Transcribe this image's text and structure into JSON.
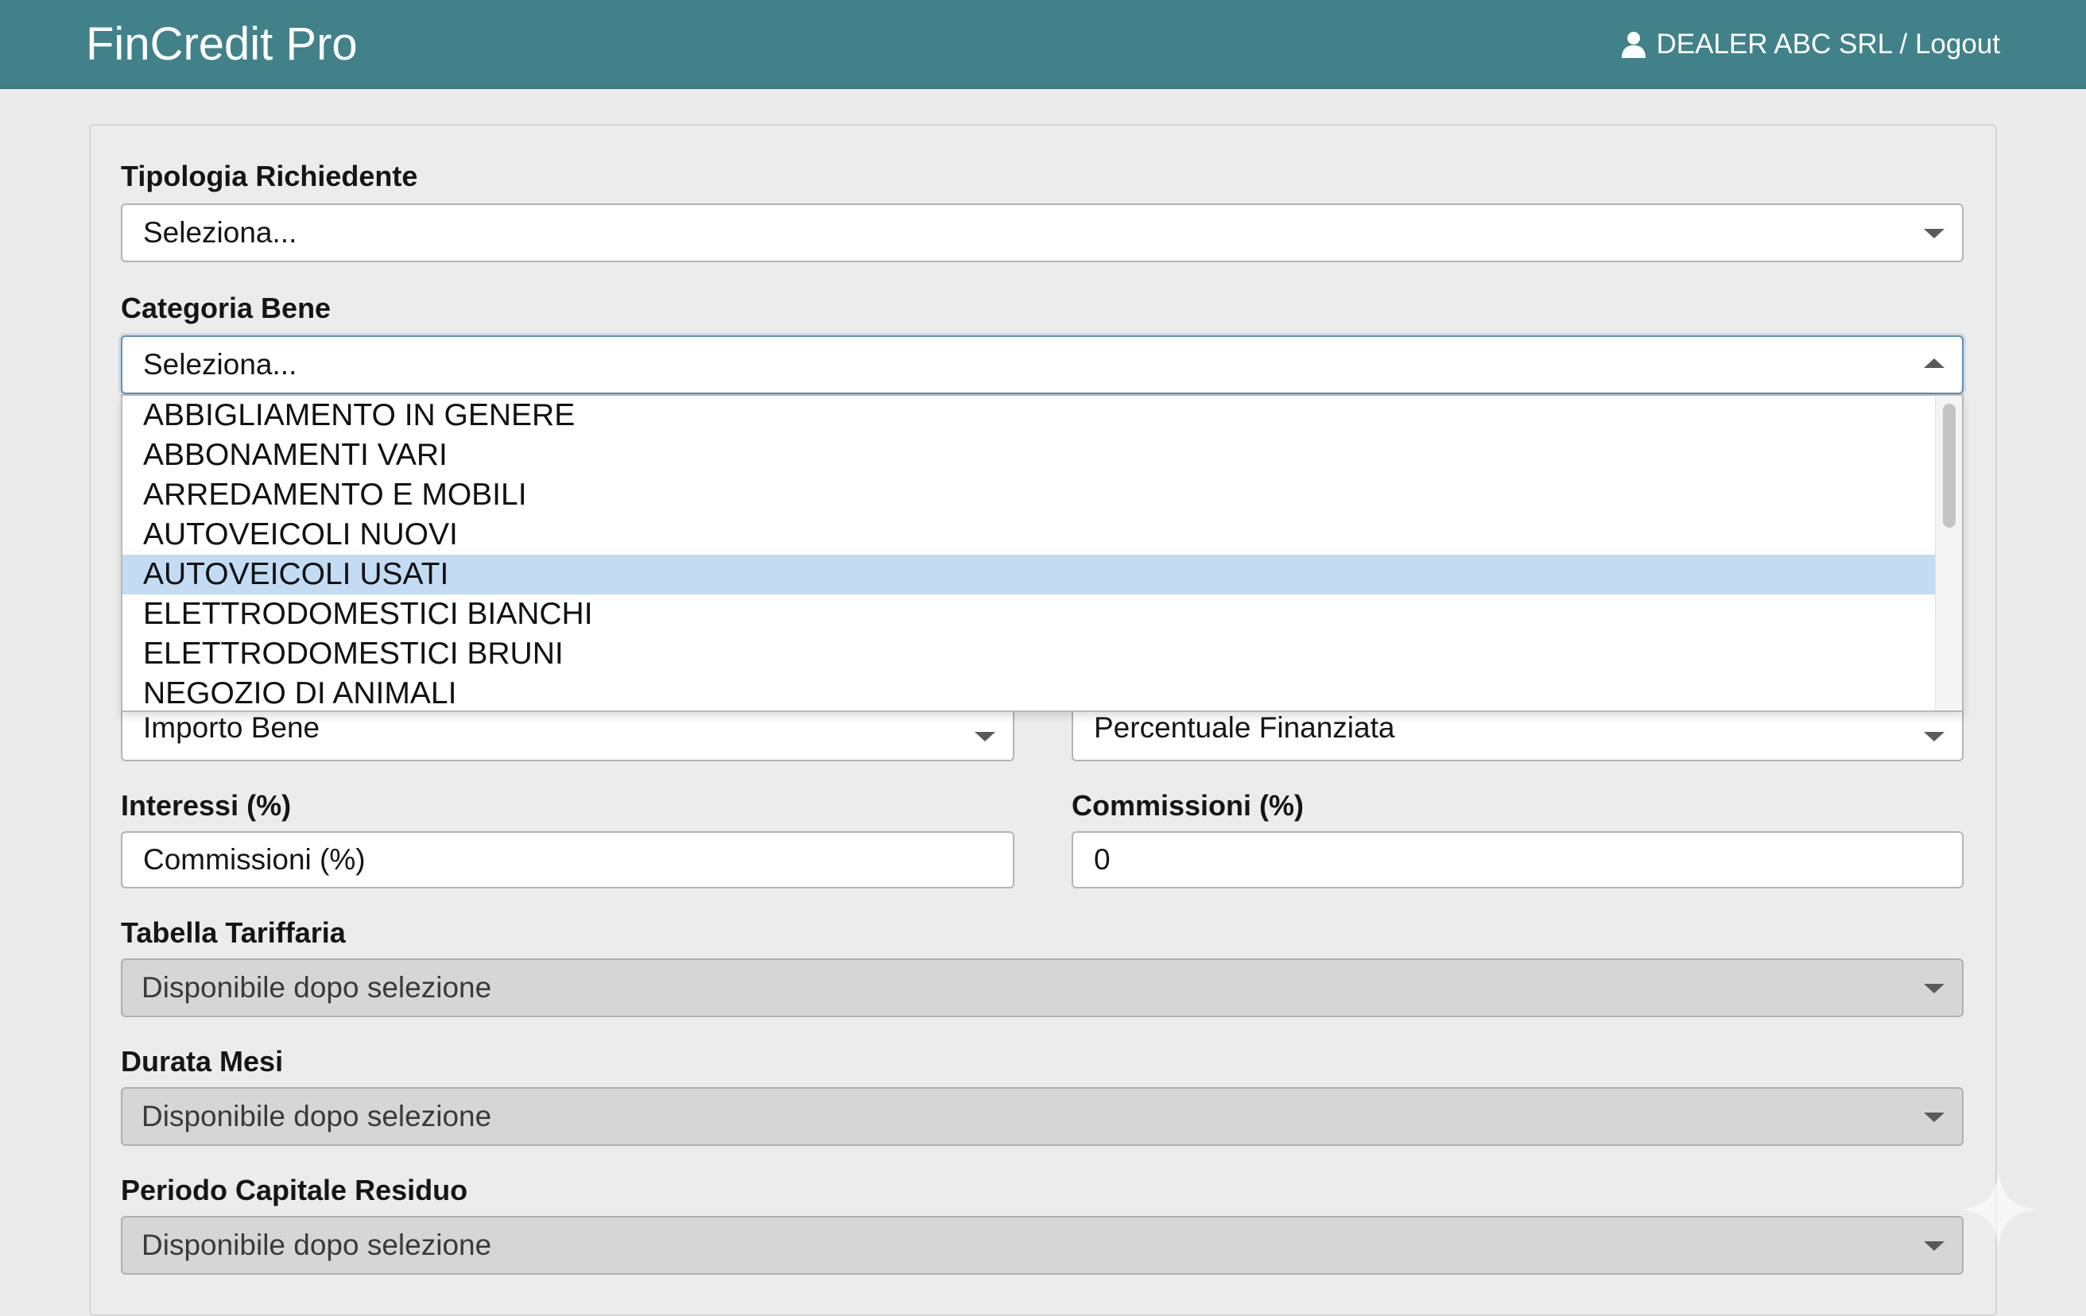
{
  "header": {
    "brand": "FinCredit Pro",
    "user_logout": "DEALER ABC SRL / Logout",
    "icons": {
      "user": "user-icon"
    },
    "colors": {
      "navbar": "#41818a",
      "highlight": "#c4dbf4"
    }
  },
  "form": {
    "tipologia": {
      "label": "Tipologia Richiedente",
      "value": "Seleziona..."
    },
    "categoria": {
      "label": "Categoria Bene",
      "value": "Seleziona...",
      "options": [
        "ABBIGLIAMENTO IN GENERE",
        "ABBONAMENTI VARI",
        "ARREDAMENTO E MOBILI",
        "AUTOVEICOLI NUOVI",
        "AUTOVEICOLI USATI",
        "ELETTRODOMESTICI BIANCHI",
        "ELETTRODOMESTICI BRUNI",
        "NEGOZIO DI ANIMALI"
      ],
      "highlighted": "AUTOVEICOLI USATI"
    },
    "importo_bene": {
      "value": "Importo Bene"
    },
    "percentuale": {
      "value": "Percentuale Finanziata"
    },
    "interessi": {
      "label": "Interessi (%)",
      "value": "Commissioni (%)"
    },
    "commissioni": {
      "label": "Commissioni (%)",
      "value": "0"
    },
    "tabella": {
      "label": "Tabella Tariffaria",
      "value": "Disponibile dopo selezione"
    },
    "durata": {
      "label": "Durata Mesi",
      "value": "Disponibile dopo selezione"
    },
    "periodo": {
      "label": "Periodo Capitale Residuo",
      "value": "Disponibile dopo selezione"
    }
  }
}
